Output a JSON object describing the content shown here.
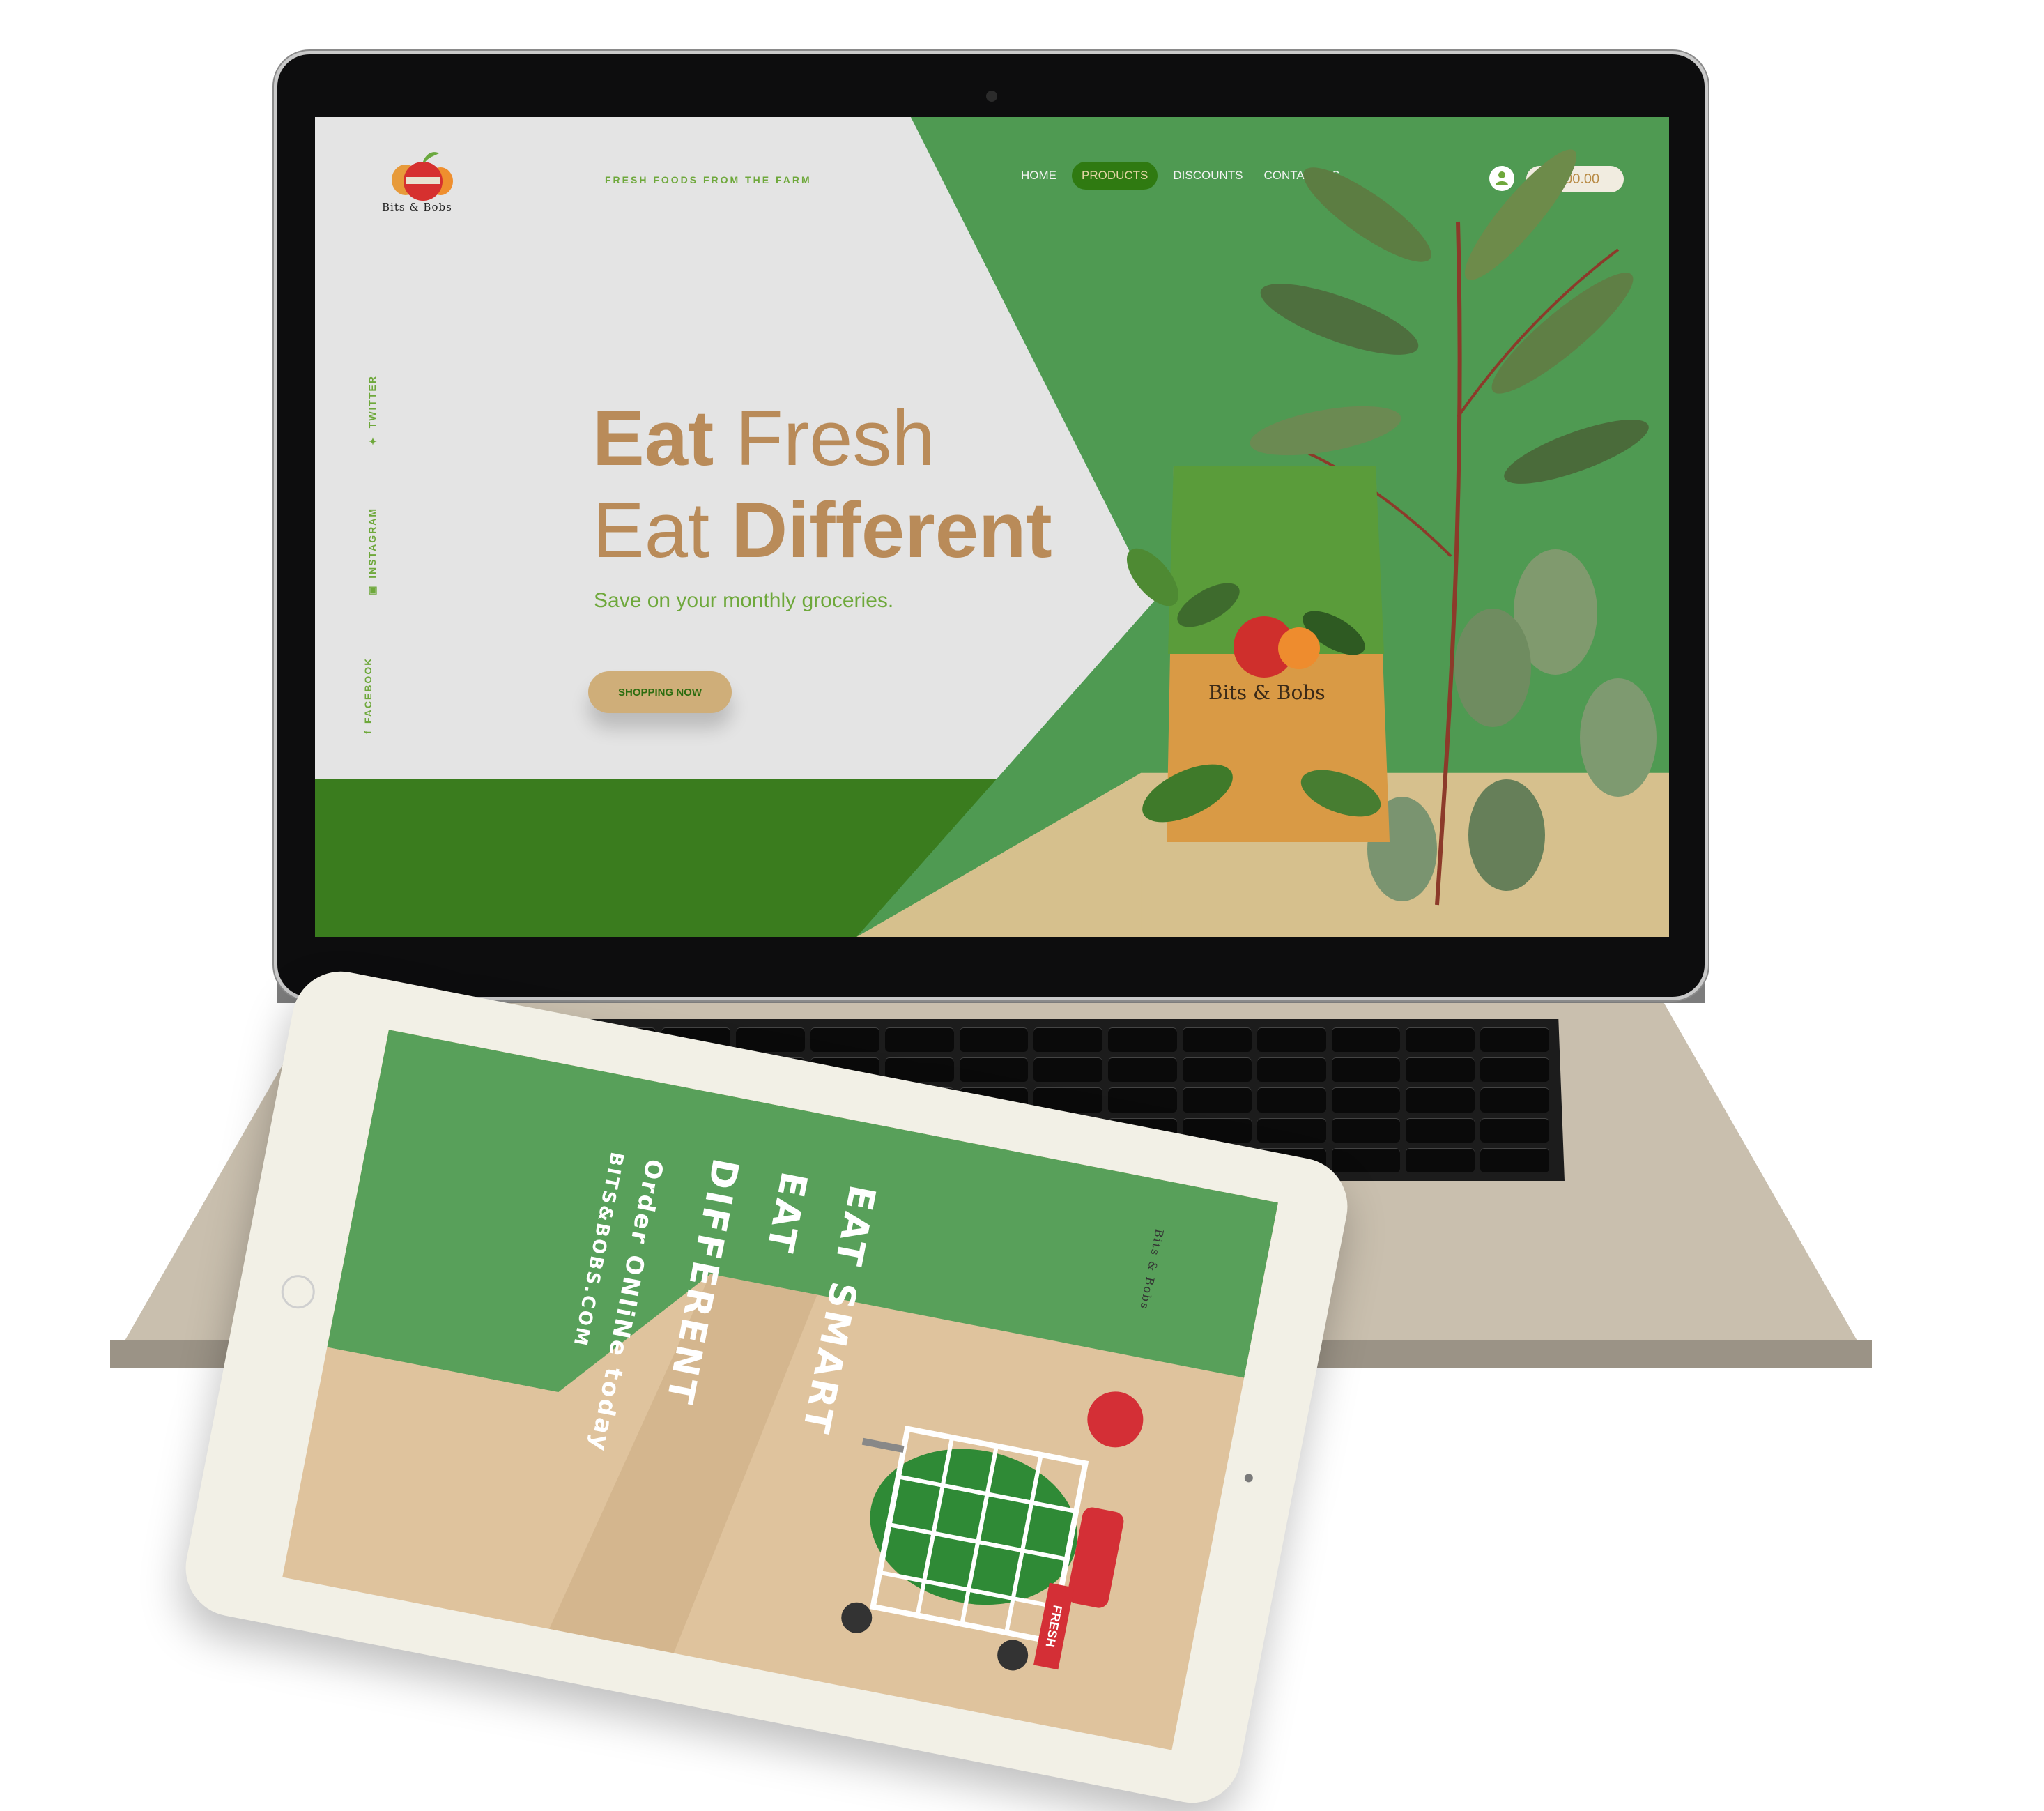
{
  "site": {
    "logo_text": "Bits & Bobs",
    "tagline": "FRESH FOODS FROM THE FARM",
    "nav": [
      {
        "label": "HOME",
        "active": false
      },
      {
        "label": "PRODUCTS",
        "active": true
      },
      {
        "label": "DISCOUNTS",
        "active": false
      },
      {
        "label": "CONTACT US",
        "active": false
      }
    ],
    "cart_total": "$00.00",
    "social": {
      "twitter": "TWITTER",
      "instagram": "INSTAGRAM",
      "facebook": "FACEBOOK"
    },
    "hero": {
      "line1_bold": "Eat",
      "line1_rest": " Fresh",
      "line2_rest": "Eat ",
      "line2_bold": "Different",
      "subtitle": "Save on your monthly groceries.",
      "cta": "SHOPPING NOW"
    },
    "bag_text": "Bits & Bobs",
    "colors": {
      "green": "#4f9a52",
      "dark_green": "#3a7c1e",
      "sand": "#d6c08d",
      "brown": "#b98b59",
      "accent_green": "#6ea83b"
    }
  },
  "tablet": {
    "logo_text": "Bits & Bobs",
    "lines": [
      "EAT SMART",
      "EAT",
      "DIFFERENT",
      "Order ONliNe today",
      "BITS&BOBS.COM"
    ],
    "fresh_tag": "FRESH"
  }
}
